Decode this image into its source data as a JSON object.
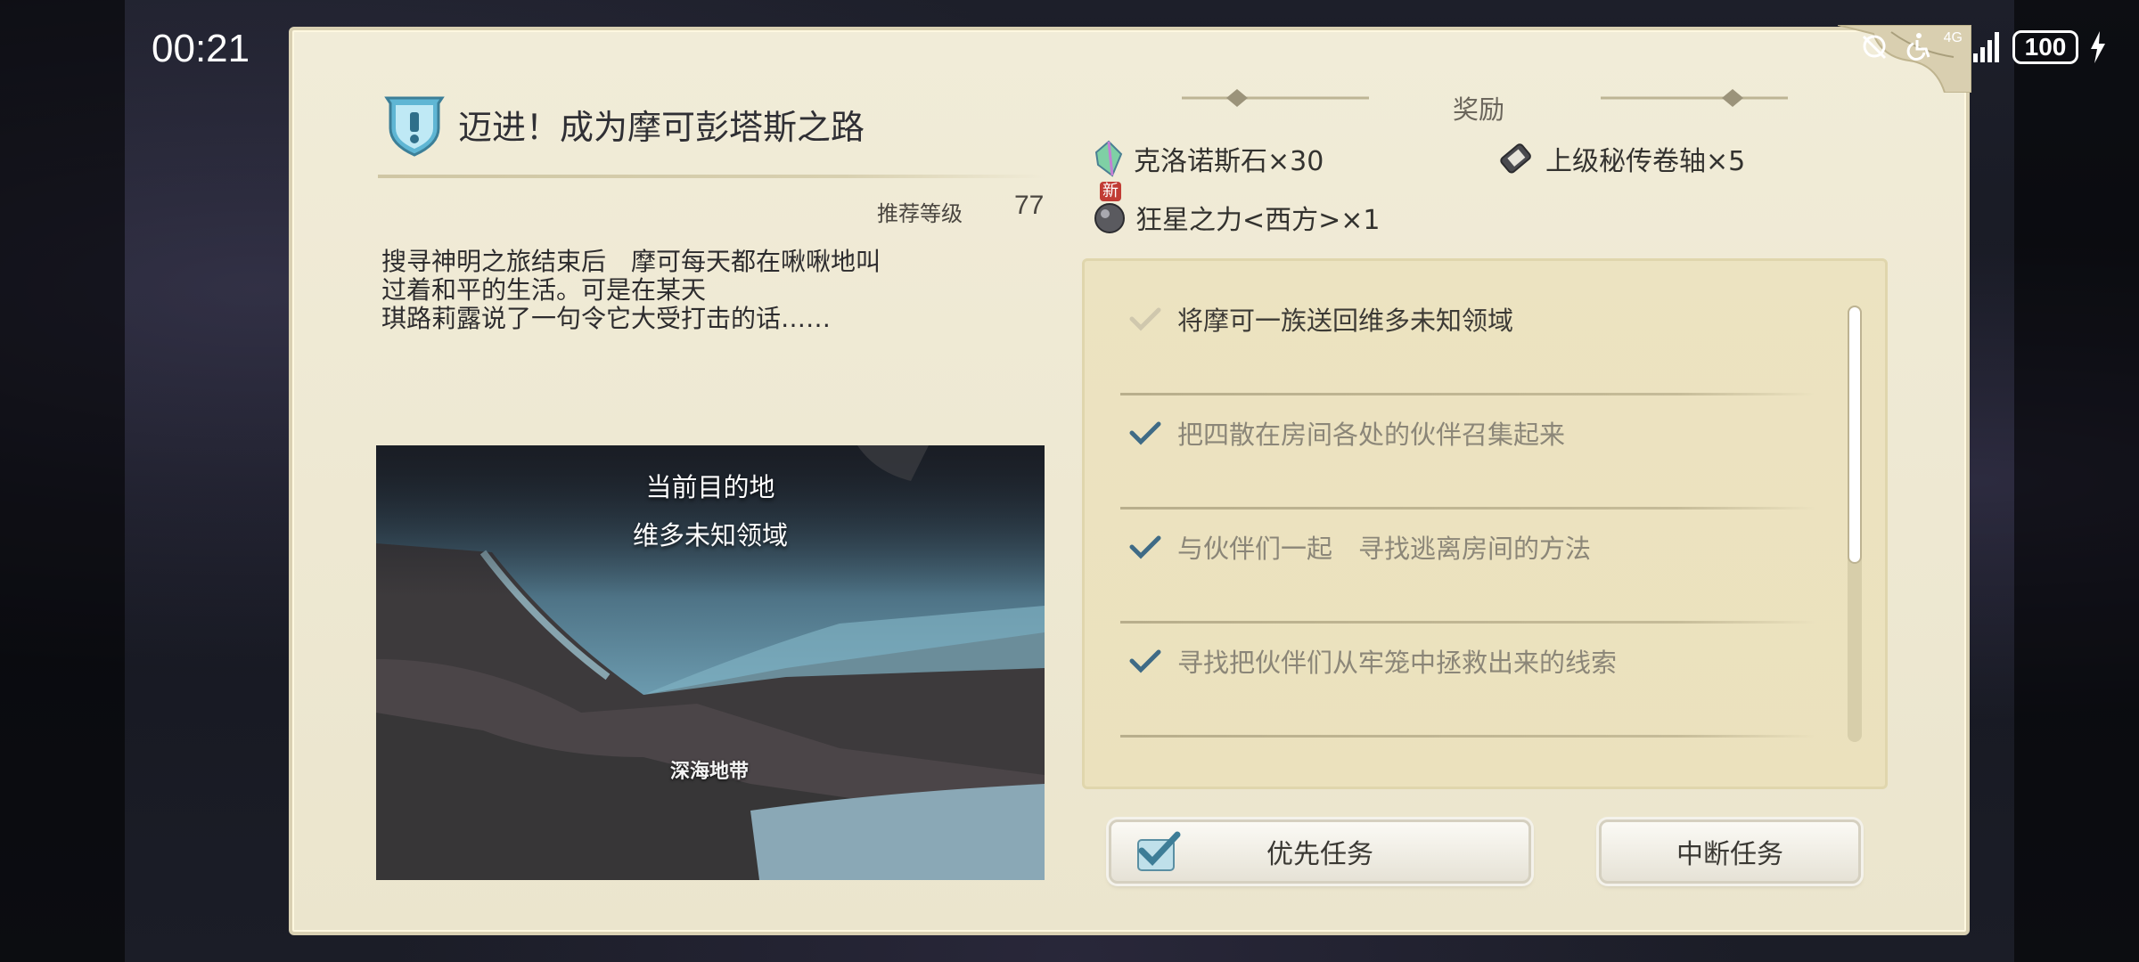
{
  "status_bar": {
    "time": "00:21",
    "network": "4G",
    "battery": "100"
  },
  "quest": {
    "title": "迈进！成为摩可彭塔斯之路",
    "level_label": "推荐等级",
    "level_value": "77",
    "description": [
      "搜寻神明之旅结束后　摩可每天都在啾啾地叫",
      "过着和平的生活。可是在某天",
      "琪路莉露说了一句令它大受打击的话……"
    ]
  },
  "map": {
    "destination_label": "当前目的地",
    "destination_name": "维多未知领域",
    "region_label": "深海地带"
  },
  "rewards": {
    "heading": "奖励",
    "items": [
      {
        "label": "克洛诺斯石×30",
        "icon": "crystal-icon"
      },
      {
        "label": "上级秘传卷轴×5",
        "icon": "scroll-icon"
      },
      {
        "label": "狂星之力<西方>×1",
        "icon": "star-ore-icon",
        "badge": "新"
      }
    ]
  },
  "objectives": [
    {
      "text": "将摩可一族送回维多未知领域",
      "status": "current"
    },
    {
      "text": "把四散在房间各处的伙伴召集起来",
      "status": "done"
    },
    {
      "text": "与伙伴们一起　寻找逃离房间的方法",
      "status": "done"
    },
    {
      "text": "寻找把伙伴们从牢笼中拯救出来的线索",
      "status": "done"
    }
  ],
  "buttons": {
    "priority": "优先任务",
    "abort": "中断任务"
  },
  "colors": {
    "panel": "#ede7d1",
    "check_done": "#3f6b86",
    "check_current": "#cfc7ad"
  }
}
